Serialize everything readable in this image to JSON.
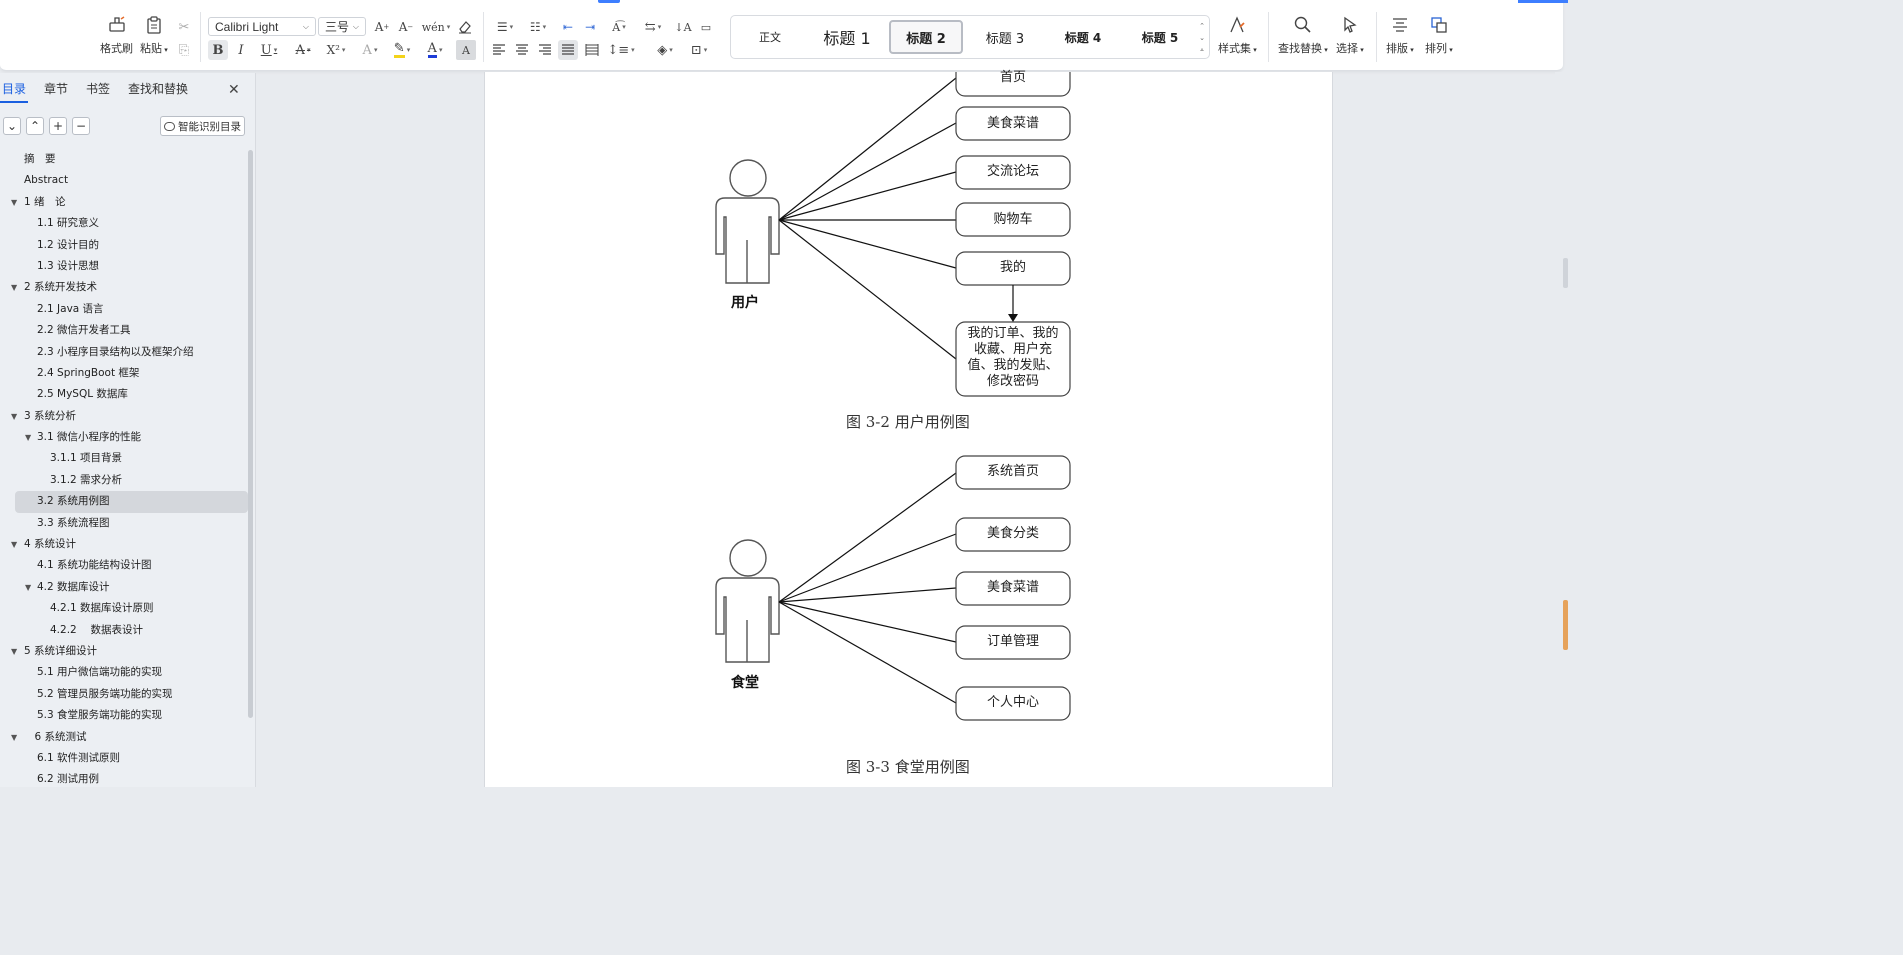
{
  "ribbon": {
    "format_painter": "格式刷",
    "paste": "粘贴",
    "font_name": "Calibri Light",
    "font_size": "三号",
    "styles": [
      "正文",
      "标题 1",
      "标题 2",
      "标题 3",
      "标题 4",
      "标题 5"
    ],
    "active_style_index": 2,
    "style_set": "样式集",
    "find_replace": "查找替换",
    "select": "选择",
    "layout": "排版",
    "arrange": "排列"
  },
  "nav": {
    "tabs": [
      "目录",
      "章节",
      "书签",
      "查找和替换"
    ],
    "smart_toc": "智能识别目录",
    "toc": [
      {
        "label": "摘　要",
        "level": 1,
        "tri": false
      },
      {
        "label": "Abstract",
        "level": 1,
        "tri": false
      },
      {
        "label": "1 绪　论",
        "level": 1,
        "tri": true
      },
      {
        "label": "1.1 研究意义",
        "level": 2,
        "tri": false
      },
      {
        "label": "1.2 设计目的",
        "level": 2,
        "tri": false
      },
      {
        "label": "1.3 设计思想",
        "level": 2,
        "tri": false
      },
      {
        "label": "2 系统开发技术",
        "level": 1,
        "tri": true
      },
      {
        "label": "2.1 Java 语言",
        "level": 2,
        "tri": false
      },
      {
        "label": "2.2 微信开发者工具",
        "level": 2,
        "tri": false
      },
      {
        "label": "2.3 小程序目录结构以及框架介绍",
        "level": 2,
        "tri": false
      },
      {
        "label": "2.4 SpringBoot 框架",
        "level": 2,
        "tri": false
      },
      {
        "label": "2.5 MySQL 数据库",
        "level": 2,
        "tri": false
      },
      {
        "label": "3 系统分析",
        "level": 1,
        "tri": true
      },
      {
        "label": "3.1 微信小程序的性能",
        "level": 2,
        "tri": true
      },
      {
        "label": "3.1.1 项目背景",
        "level": 3,
        "tri": false
      },
      {
        "label": "3.1.2 需求分析",
        "level": 3,
        "tri": false
      },
      {
        "label": "3.2 系统用例图",
        "level": 2,
        "tri": false,
        "selected": true
      },
      {
        "label": "3.3  系统流程图",
        "level": 2,
        "tri": false
      },
      {
        "label": "4  系统设计",
        "level": 1,
        "tri": true
      },
      {
        "label": "4.1 系统功能结构设计图",
        "level": 2,
        "tri": false
      },
      {
        "label": "4.2 数据库设计",
        "level": 2,
        "tri": true
      },
      {
        "label": "4.2.1 数据库设计原则",
        "level": 3,
        "tri": false
      },
      {
        "label": "4.2.2　 数据表设计",
        "level": 3,
        "tri": false
      },
      {
        "label": "5 系统详细设计",
        "level": 1,
        "tri": true
      },
      {
        "label": "5.1 用户微信端功能的实现",
        "level": 2,
        "tri": false
      },
      {
        "label": "5.2 管理员服务端功能的实现",
        "level": 2,
        "tri": false
      },
      {
        "label": "5.3 食堂服务端功能的实现",
        "level": 2,
        "tri": false
      },
      {
        "label": "　6  系统测试",
        "level": 1,
        "tri": true
      },
      {
        "label": "6.1 软件测试原则",
        "level": 2,
        "tri": false
      },
      {
        "label": "6.2 测试用例",
        "level": 2,
        "tri": false
      }
    ]
  },
  "doc": {
    "diagram1": {
      "actor": "用户",
      "cases": [
        "首页",
        "美食菜谱",
        "交流论坛",
        "购物车",
        "我的"
      ],
      "sub_case": [
        "我的订单、我的",
        "收藏、用户充",
        "值、我的发贴、",
        "修改密码"
      ],
      "caption": "图 3-2 用户用例图"
    },
    "diagram2": {
      "actor": "食堂",
      "cases": [
        "系统首页",
        "美食分类",
        "美食菜谱",
        "订单管理",
        "个人中心"
      ],
      "caption": "图 3-3 食堂用例图"
    }
  }
}
